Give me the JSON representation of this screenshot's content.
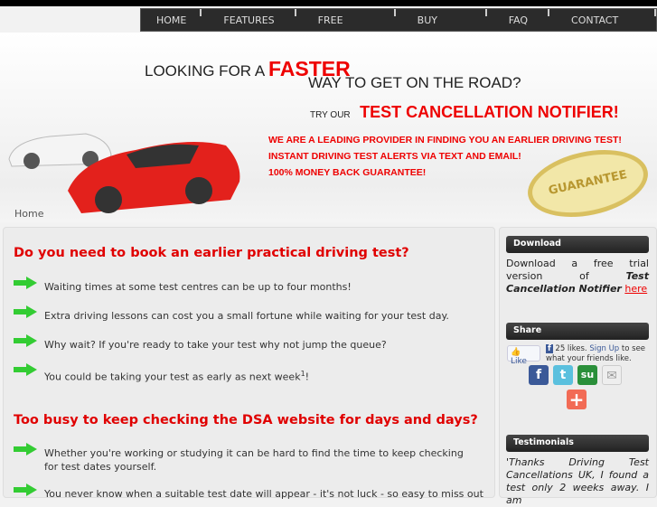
{
  "nav": [
    "HOME",
    "FEATURES",
    "FREE TRIAL",
    "BUY NOW",
    "FAQ",
    "CONTACT US"
  ],
  "banner": {
    "line1a": "LOOKING FOR A",
    "line1b": "FASTER",
    "line2": "WAY TO GET ON THE ROAD?",
    "try": "TRY OUR",
    "product": "TEST CANCELLATION NOTIFIER!",
    "claims": [
      "WE ARE A LEADING PROVIDER IN FINDING YOU AN EARLIER DRIVING TEST!",
      "INSTANT DRIVING TEST ALERTS VIA TEXT AND EMAIL!",
      "100% MONEY BACK GUARANTEE!"
    ],
    "seal": "GUARANTEE SATISFACTION"
  },
  "breadcrumb": "Home",
  "main": {
    "h1": "Do you need to book an earlier practical driving test?",
    "items1": [
      "Waiting times at some test centres can be up to four months!",
      "Extra driving lessons can cost you a small fortune while waiting for your test day.",
      "Why wait? If you're ready to take your test why not jump the queue?",
      "You could be taking your test as early as next week"
    ],
    "sup": "1",
    "excl": "!",
    "h2": "Too busy to keep checking the DSA website for days and days?",
    "items2": [
      "Whether you're working or studying it can be hard to find the time to keep checking for test dates yourself.",
      "You never know when a suitable test date will appear - it's not luck - so easy to miss out"
    ]
  },
  "sidebar": {
    "download": {
      "title": "Download",
      "text": "Download a free trial version of",
      "product": "Test Cancellation Notifier",
      "link": "here"
    },
    "share": {
      "title": "Share",
      "like": "Like",
      "likes": "25 likes.",
      "signup": "Sign Up",
      "rest": "to see what your friends like."
    },
    "testimonials": {
      "title": "Testimonials",
      "text": "'Thanks Driving Test Cancellations UK, I found a test only 2 weeks away. I am"
    }
  }
}
